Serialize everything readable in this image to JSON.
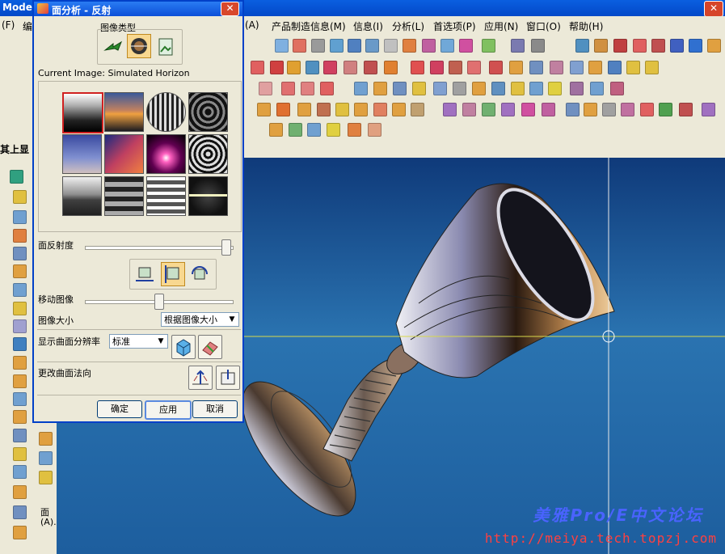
{
  "app": {
    "title": "Modeli",
    "close_glyph": "✕"
  },
  "menu": {
    "items": [
      "(F)",
      "编",
      "(A)",
      "产品制造信息(M)",
      "信息(I)",
      "分析(L)",
      "首选项(P)",
      "应用(N)",
      "窗口(O)",
      "帮助(H)"
    ]
  },
  "left_panel": {
    "label": "其上显",
    "vertical_label": "面(A)..."
  },
  "dialog": {
    "title": "面分析 - 反射",
    "close_glyph": "✕",
    "image_type_label": "图像类型",
    "current_image_label": "Current Image: Simulated Horizon",
    "face_reflectivity_label": "面反射度",
    "face_reflectivity_value": 0.98,
    "move_image_label": "移动图像",
    "move_image_value": 0.5,
    "image_size_label": "图像大小",
    "image_size_value": "根据图像大小",
    "display_resolution_label": "显示曲面分辨率",
    "display_resolution_value": "标准",
    "change_normal_label": "更改曲面法向",
    "ok_label": "确定",
    "apply_label": "应用",
    "cancel_label": "取消",
    "images": [
      {
        "name": "simulated-horizon",
        "selected": true
      },
      {
        "name": "sunset",
        "selected": false
      },
      {
        "name": "room-lines",
        "selected": false
      },
      {
        "name": "dark-rings",
        "selected": false
      },
      {
        "name": "blue-sky",
        "selected": false
      },
      {
        "name": "purple-sky",
        "selected": false
      },
      {
        "name": "magenta-glow",
        "selected": false
      },
      {
        "name": "concentric-rings",
        "selected": false
      },
      {
        "name": "grey-landscape",
        "selected": false
      },
      {
        "name": "gray-bands",
        "selected": false
      },
      {
        "name": "gray-stripes",
        "selected": false
      },
      {
        "name": "horizon-line-sphere",
        "selected": false
      }
    ]
  },
  "watermark": {
    "title": "美雅Pro/E中文论坛",
    "url": "http://meiya.tech.topzj.com"
  },
  "colors": {
    "titlebar": "#0a5fe0",
    "viewport_top": "#0f3a7a",
    "viewport_bottom": "#1d5e9e",
    "crosshair": "#d8d84a",
    "watermark_title": "#4a63ff",
    "watermark_url": "#ff4040"
  }
}
